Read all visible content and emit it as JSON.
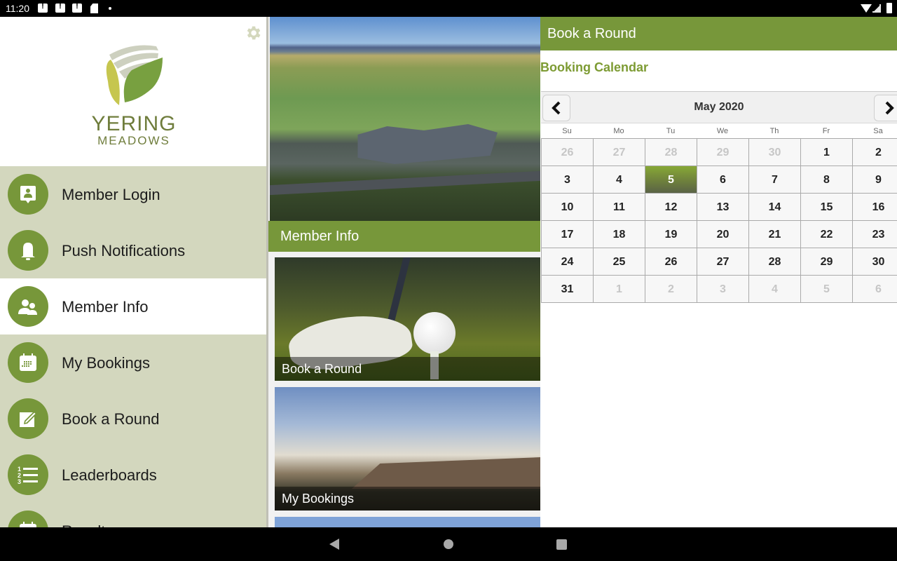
{
  "status_bar": {
    "time": "11:20",
    "icons": [
      "notification-alert-icon",
      "notification-alert-icon",
      "notification-alert-icon",
      "sd-card-icon",
      "dot-icon",
      "wifi-icon",
      "signal-icon",
      "battery-icon"
    ]
  },
  "drawer": {
    "logo": {
      "line1": "YERING",
      "line2": "MEADOWS"
    },
    "settings_icon": "gear-icon",
    "items": [
      {
        "label": "Member Login",
        "icon": "member-login-icon",
        "active": false
      },
      {
        "label": "Push Notifications",
        "icon": "bell-icon",
        "active": false
      },
      {
        "label": "Member Info",
        "icon": "members-icon",
        "active": true
      },
      {
        "label": "My Bookings",
        "icon": "calendar-icon",
        "active": false
      },
      {
        "label": "Book a Round",
        "icon": "edit-icon",
        "active": false
      },
      {
        "label": "Leaderboards",
        "icon": "ranked-list-icon",
        "active": false
      },
      {
        "label": "Results",
        "icon": "calendar-icon",
        "active": false
      }
    ]
  },
  "middle": {
    "section_title": "Member Info",
    "tiles": [
      {
        "caption": "Book a Round"
      },
      {
        "caption": "My Bookings"
      }
    ]
  },
  "right": {
    "header": "Book a Round",
    "calendar_title": "Booking Calendar",
    "calendar": {
      "month_label": "May 2020",
      "prev_icon": "chevron-left-icon",
      "next_icon": "chevron-right-icon",
      "weekdays": [
        "Su",
        "Mo",
        "Tu",
        "We",
        "Th",
        "Fr",
        "Sa"
      ],
      "selected_day": 5,
      "weeks": [
        [
          {
            "d": "26",
            "o": true
          },
          {
            "d": "27",
            "o": true
          },
          {
            "d": "28",
            "o": true
          },
          {
            "d": "29",
            "o": true
          },
          {
            "d": "30",
            "o": true
          },
          {
            "d": "1",
            "o": false
          },
          {
            "d": "2",
            "o": false
          }
        ],
        [
          {
            "d": "3",
            "o": false
          },
          {
            "d": "4",
            "o": false
          },
          {
            "d": "5",
            "o": false,
            "s": true
          },
          {
            "d": "6",
            "o": false
          },
          {
            "d": "7",
            "o": false
          },
          {
            "d": "8",
            "o": false
          },
          {
            "d": "9",
            "o": false
          }
        ],
        [
          {
            "d": "10",
            "o": false
          },
          {
            "d": "11",
            "o": false
          },
          {
            "d": "12",
            "o": false
          },
          {
            "d": "13",
            "o": false
          },
          {
            "d": "14",
            "o": false
          },
          {
            "d": "15",
            "o": false
          },
          {
            "d": "16",
            "o": false
          }
        ],
        [
          {
            "d": "17",
            "o": false
          },
          {
            "d": "18",
            "o": false
          },
          {
            "d": "19",
            "o": false
          },
          {
            "d": "20",
            "o": false
          },
          {
            "d": "21",
            "o": false
          },
          {
            "d": "22",
            "o": false
          },
          {
            "d": "23",
            "o": false
          }
        ],
        [
          {
            "d": "24",
            "o": false
          },
          {
            "d": "25",
            "o": false
          },
          {
            "d": "26",
            "o": false
          },
          {
            "d": "27",
            "o": false
          },
          {
            "d": "28",
            "o": false
          },
          {
            "d": "29",
            "o": false
          },
          {
            "d": "30",
            "o": false
          }
        ],
        [
          {
            "d": "31",
            "o": false
          },
          {
            "d": "1",
            "o": true
          },
          {
            "d": "2",
            "o": true
          },
          {
            "d": "3",
            "o": true
          },
          {
            "d": "4",
            "o": true
          },
          {
            "d": "5",
            "o": true
          },
          {
            "d": "6",
            "o": true
          }
        ]
      ]
    }
  },
  "nav_bar": {
    "buttons": [
      "back-icon",
      "home-icon",
      "recents-icon"
    ]
  },
  "colors": {
    "accent": "#77973a",
    "drawer_bg": "#d3d7be",
    "title_green": "#7d9b33"
  }
}
